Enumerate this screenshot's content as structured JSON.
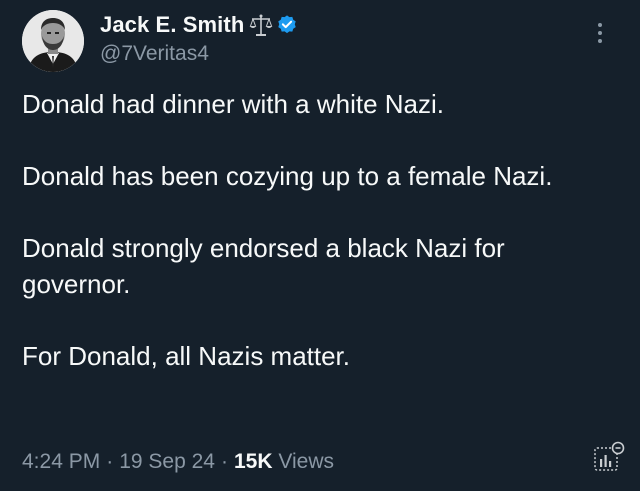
{
  "author": {
    "display_name": "Jack E. Smith",
    "handle": "@7Veritas4",
    "badge_icons": [
      "scales-icon",
      "verified-icon"
    ],
    "verified_color": "#1d9bf0"
  },
  "tweet": {
    "paragraphs": [
      "Donald had dinner with a white Nazi.",
      "Donald has been cozying up to a female Nazi.",
      "Donald strongly endorsed a black Nazi for governor.",
      "For Donald, all Nazis matter."
    ]
  },
  "meta": {
    "time": "4:24 PM",
    "separator": "·",
    "date": "19 Sep 24",
    "views_count": "15K",
    "views_label": "Views"
  },
  "colors": {
    "background": "#15202b",
    "text_primary": "#f7f9f9",
    "text_secondary": "#8b98a5"
  }
}
